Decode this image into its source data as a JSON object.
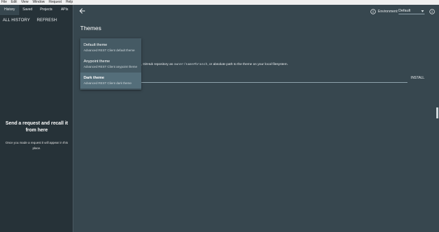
{
  "menubar": {
    "items": [
      "File",
      "Edit",
      "View",
      "Window",
      "Request",
      "Help"
    ]
  },
  "sidebar": {
    "tabs": [
      "History",
      "Saved",
      "Projects",
      "APIs"
    ],
    "actions": [
      "ALL HISTORY",
      "REFRESH"
    ],
    "empty_title": "Send a request and recall it from here",
    "empty_message": "Once you made a request it will appear in this place."
  },
  "header": {
    "environment_label": "Environment:",
    "environment_value": "Default"
  },
  "main": {
    "title": "Themes",
    "description_prefix": "e, GitHub repository as ",
    "description_code": "owner/name#branch",
    "description_suffix": ", or absolute path to the theme on your local filesystem.",
    "install_label": "INSTALL"
  },
  "theme_dropdown": {
    "options": [
      {
        "name": "Default theme",
        "description": "Advanced REST Client default theme"
      },
      {
        "name": "Anypoint theme",
        "description": "Advanced REST Client anypoint theme"
      },
      {
        "name": "Dark theme",
        "description": "Advanced REST Client dark theme",
        "selected": true
      }
    ]
  },
  "colors": {
    "sidebar_bg": "#263238",
    "main_bg": "#37474f",
    "dropdown_bg": "#455a64",
    "selected_bg": "#546e7a"
  },
  "icons": {
    "back": "arrow-left-icon",
    "info": "info-icon",
    "caret": "caret-down-icon"
  }
}
